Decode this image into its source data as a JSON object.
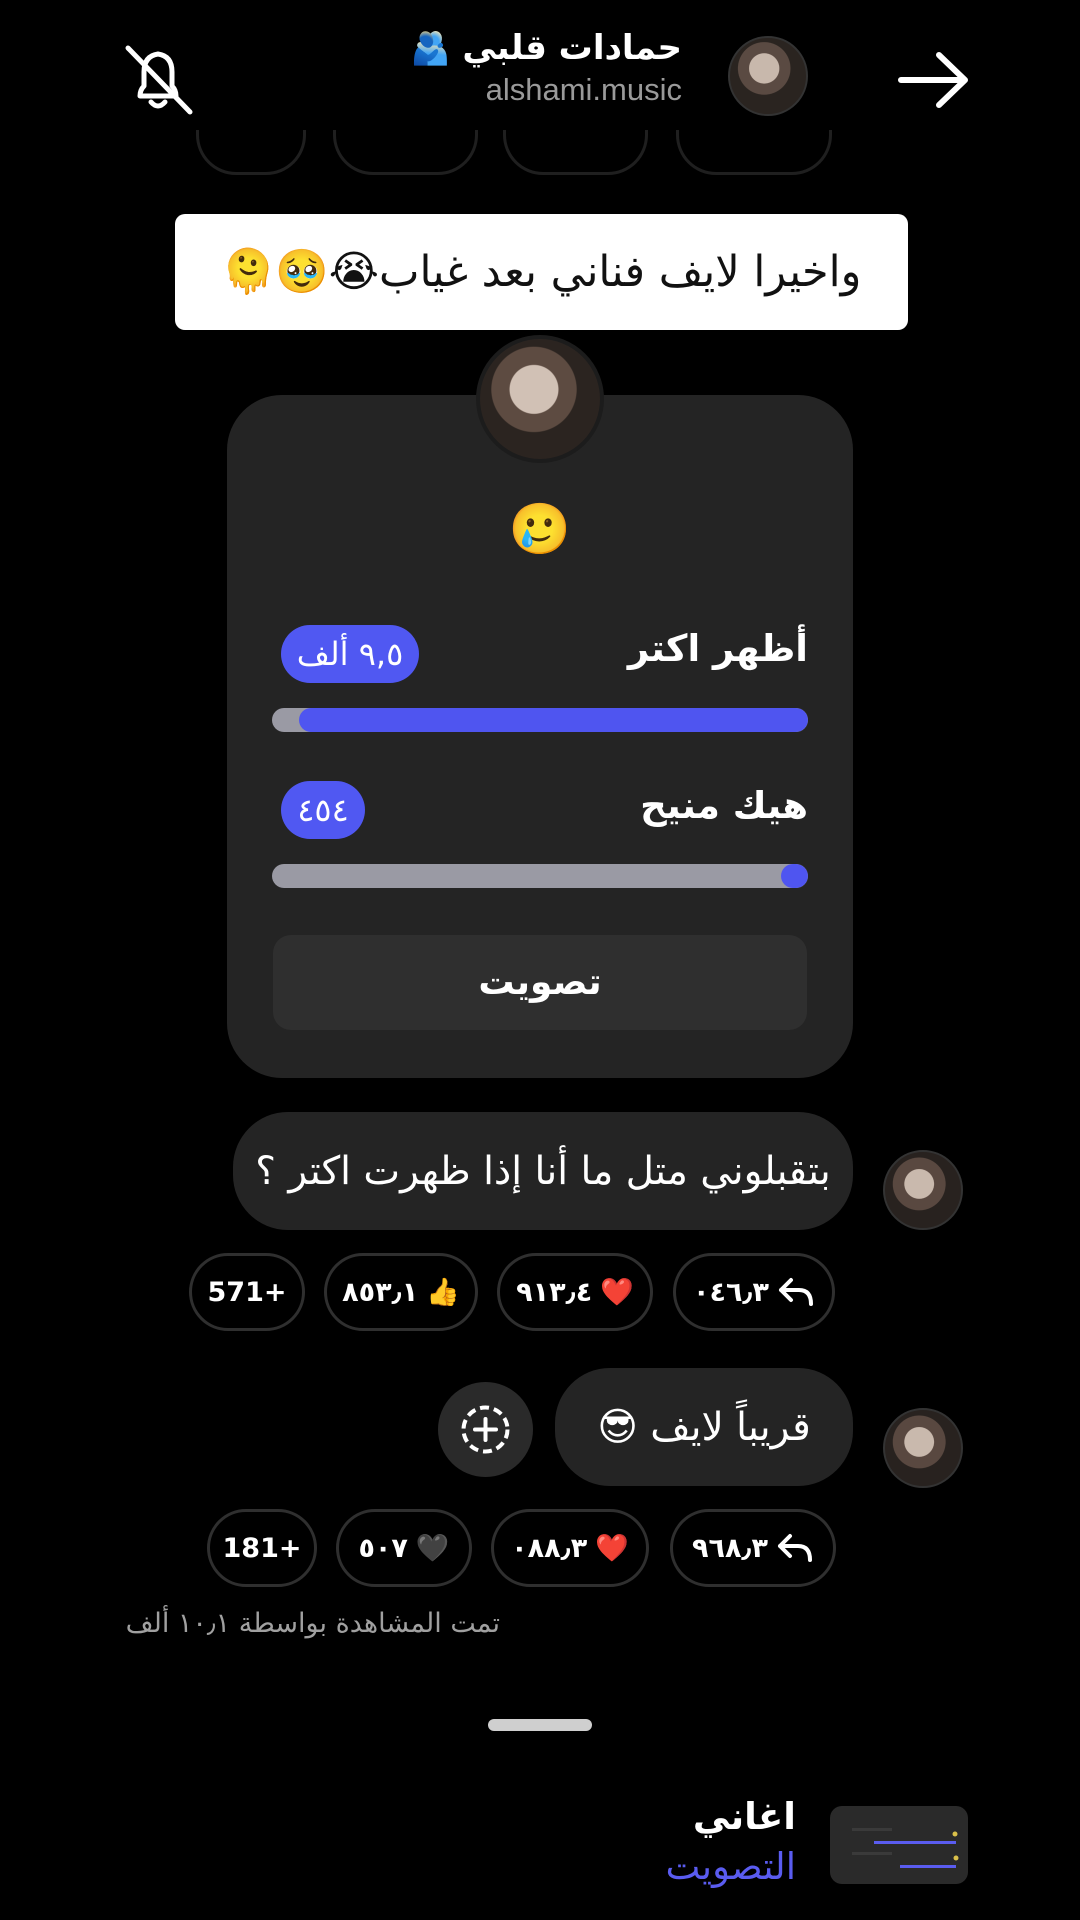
{
  "header": {
    "title": "حمادات قلبي",
    "title_emoji": "🫂",
    "subtitle": "alshami.music",
    "back_icon": "arrow-right-icon",
    "mute_icon": "bell-off-icon"
  },
  "banner": {
    "text": "واخيرا لايف فناني بعد غياب😭🥹🫠"
  },
  "poll": {
    "emoji": "🥲",
    "options": [
      {
        "label": "أظهر اكتر",
        "count": "٩,٥ ألف",
        "fraction": 0.95
      },
      {
        "label": "هيك منيح",
        "count": "٤٥٤",
        "fraction": 0.05
      }
    ],
    "vote_label": "تصويت"
  },
  "messages": [
    {
      "text": "بتقبلوني متل ما أنا إذا ظهرت اكتر ؟",
      "reactions": [
        {
          "icon": "reply-icon",
          "glyph": "",
          "count": "٠٤٦٫٣"
        },
        {
          "icon": "heart-icon",
          "glyph": "❤️",
          "count": "٩١٣٫٤"
        },
        {
          "icon": "thumbs-up-icon",
          "glyph": "👍",
          "count": "٨٥٣٫١"
        },
        {
          "icon": "",
          "glyph": "",
          "count": "571+"
        }
      ]
    },
    {
      "text": "قريباً لايف 😎",
      "reactions": [
        {
          "icon": "reply-icon",
          "glyph": "",
          "count": "٩٦٨٫٣"
        },
        {
          "icon": "heart-icon",
          "glyph": "❤️",
          "count": "٠٨٨٫٣"
        },
        {
          "icon": "black-heart-icon",
          "glyph": "🖤",
          "count": "٥٠٧"
        },
        {
          "icon": "",
          "glyph": "",
          "count": "181+"
        }
      ]
    }
  ],
  "seen_text": "تمت المشاهدة بواسطة ١٠٫١ ألف",
  "bottom": {
    "title": "اغاني",
    "subtitle": "التصويت"
  },
  "colors": {
    "accent": "#4f55f0",
    "bubble": "#242424"
  }
}
